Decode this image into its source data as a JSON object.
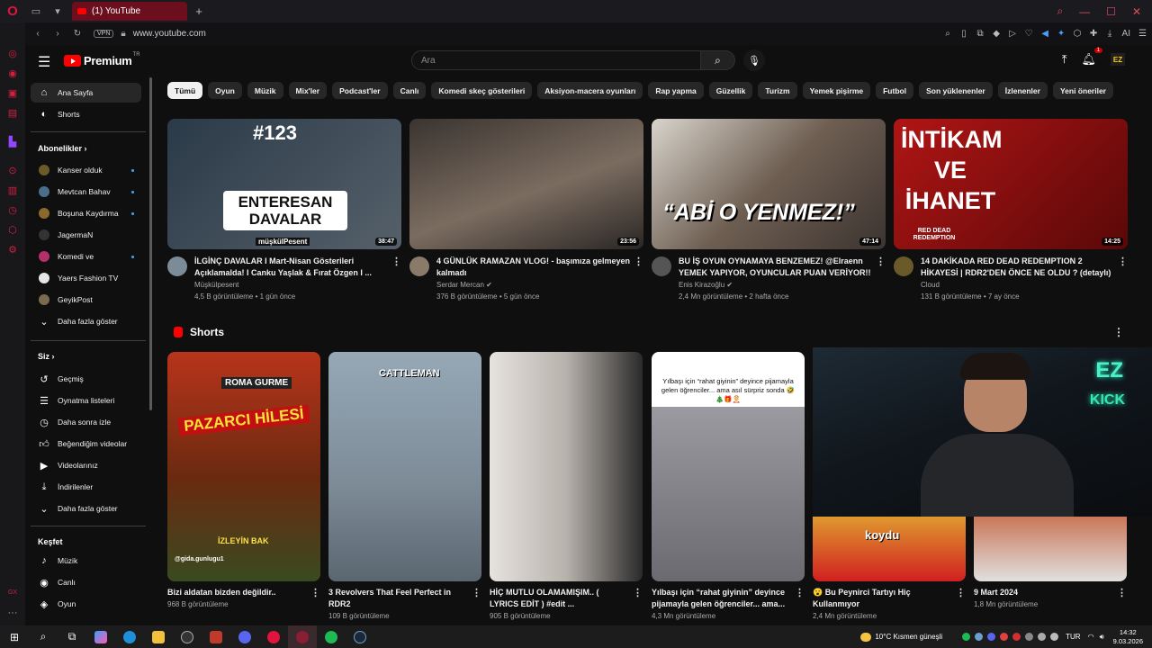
{
  "browser": {
    "tab_title": "(1) YouTube",
    "new_tab": "+",
    "url": "www.youtube.com",
    "vpn": "VPN",
    "ai_label": "AI"
  },
  "header": {
    "logo_word": "Premium",
    "logo_region": "TR",
    "search_placeholder": "Ara",
    "notification_count": "1",
    "avatar_text": "EZ"
  },
  "guide": {
    "main": [
      {
        "label": "Ana Sayfa",
        "icon": "home-icon"
      },
      {
        "label": "Shorts",
        "icon": "shorts-icon"
      }
    ],
    "subscriptions_title": "Abonelikler",
    "subscriptions": [
      {
        "label": "Kanser olduk",
        "color": "#6b5a2a"
      },
      {
        "label": "Mevtcan Bahav",
        "color": "#4a6f8c"
      },
      {
        "label": "Boşuna Kaydırma",
        "color": "#8a6a2a"
      },
      {
        "label": "JagermaN",
        "color": "#333333"
      },
      {
        "label": "Komedi ve",
        "color": "#b3306a"
      },
      {
        "label": "Yaers Fashion TV",
        "color": "#e6e6e6"
      },
      {
        "label": "GeyikPost",
        "color": "#7a6a50"
      }
    ],
    "subs_more": "Daha fazla göster",
    "you_title": "Siz",
    "you": [
      {
        "label": "Geçmiş",
        "icon": "history-icon"
      },
      {
        "label": "Oynatma listeleri",
        "icon": "playlist-icon"
      },
      {
        "label": "Daha sonra izle",
        "icon": "watch-later-icon"
      },
      {
        "label": "Beğendiğim videolar",
        "icon": "like-icon"
      },
      {
        "label": "Videolarınız",
        "icon": "your-videos-icon"
      },
      {
        "label": "İndirilenler",
        "icon": "download-icon"
      }
    ],
    "you_more": "Daha fazla göster",
    "explore_title": "Keşfet",
    "explore": [
      {
        "label": "Müzik",
        "icon": "music-icon"
      },
      {
        "label": "Canlı",
        "icon": "live-icon"
      },
      {
        "label": "Oyun",
        "icon": "gaming-icon"
      }
    ]
  },
  "chips": [
    "Tümü",
    "Oyun",
    "Müzik",
    "Mix'ler",
    "Podcast'ler",
    "Canlı",
    "Komedi skeç gösterileri",
    "Aksiyon-macera oyunları",
    "Rap yapma",
    "Güzellik",
    "Turizm",
    "Yemek pişirme",
    "Futbol",
    "Son yüklenenler",
    "İzlenenler",
    "Yeni öneriler"
  ],
  "videos": [
    {
      "title": "İLGİNÇ DAVALAR I Mart-Nisan Gösterileri Açıklamalda! I Canku Yaşlak & Fırat Özgen I ...",
      "channel": "Müşkülpesent",
      "stats": "4,5 B görüntüleme • 1 gün önce",
      "duration": "38:47",
      "thumb_text": "ENTERESAN DAVALAR",
      "thumb_num": "#123",
      "thumb_tag": "müşkülPesent",
      "bg": "#3a4a5a"
    },
    {
      "title": "4 GÜNLÜK RAMAZAN VLOG! - başımıza gelmeyen kalmadı",
      "channel": "Serdar Mercan",
      "stats": "376 B görüntüleme • 5 gün önce",
      "duration": "23:56",
      "bg": "#5b5048"
    },
    {
      "title": "BU İŞ OYUN OYNAMAYA BENZEMEZ! @Elraenn YEMEK YAPIYOR, OYUNCULAR PUAN VERİYOR!!",
      "channel": "Enis Kirazoğlu",
      "stats": "2,4 Mn görüntüleme • 2 hafta önce",
      "duration": "47:14",
      "thumb_text": "“ABİ O YENMEZ!”",
      "bg": "#6a5a4e"
    },
    {
      "title": "14 DAKİKADA RED DEAD REDEMPTION 2 HİKAYESİ | RDR2'DEN ÖNCE NE OLDU ? (detaylı)",
      "channel": "Cloud",
      "stats": "131 B görüntüleme • 7 ay önce",
      "duration": "14:25",
      "thumb_text": "İNTİKAM VE İHANET",
      "thumb_tag": "RED DEAD REDEMPTION",
      "bg": "#8a1010"
    }
  ],
  "shorts": {
    "title": "Shorts",
    "items": [
      {
        "title": "Bizi aldatan bizden değildir..",
        "views": "968 B görüntüleme",
        "overlay": "PAZARCI HİLESİ",
        "overlay2": "İZLEYİN BAK",
        "brand": "ROMA GURME",
        "tag": "@gida.gunlugu1",
        "bg": "#8a3a1a"
      },
      {
        "title": "3 Revolvers That Feel Perfect in RDR2",
        "views": "109 B görüntüleme",
        "overlay": "CATTLEMAN",
        "bg": "#8aa0b0"
      },
      {
        "title": "HİÇ MUTLU OLAMAMIŞIM.. ( LYRICS EDİT ) #edit ...",
        "views": "905 B görüntüleme",
        "bg": "#c8c4c0"
      },
      {
        "title": "Yılbaşı için “rahat giyinin” deyince pijamayla gelen öğrenciler... ama...",
        "views": "4,3 Mn görüntüleme",
        "overlay": "Yılbaşı için “rahat giyinin” deyince pijamayla gelen öğrenciler... ama asıl sürpriz sonda 🤣🎄🎁🤶",
        "bg": "#e8e8e8"
      },
      {
        "title": "😮 Bu Peynirci Tartıyı Hiç Kullanmıyor",
        "views": "2,4 Mn görüntüleme",
        "overlay": "koydu",
        "bg": "#d9a030"
      },
      {
        "title": "9 Mart 2024",
        "views": "1,8 Mn görüntüleme",
        "bg": "#c07050"
      }
    ]
  },
  "webcam": {
    "neon1": "EZ",
    "neon2": "KICK"
  },
  "tray": {
    "weather": "10°C  Kısmen güneşli",
    "lang": "TUR",
    "time": "14:32",
    "date": "9.03.2026"
  },
  "colors": {
    "accent": "#ff0000",
    "background": "#0f0f0f",
    "chip": "#272727",
    "opera": "#e0143c"
  }
}
